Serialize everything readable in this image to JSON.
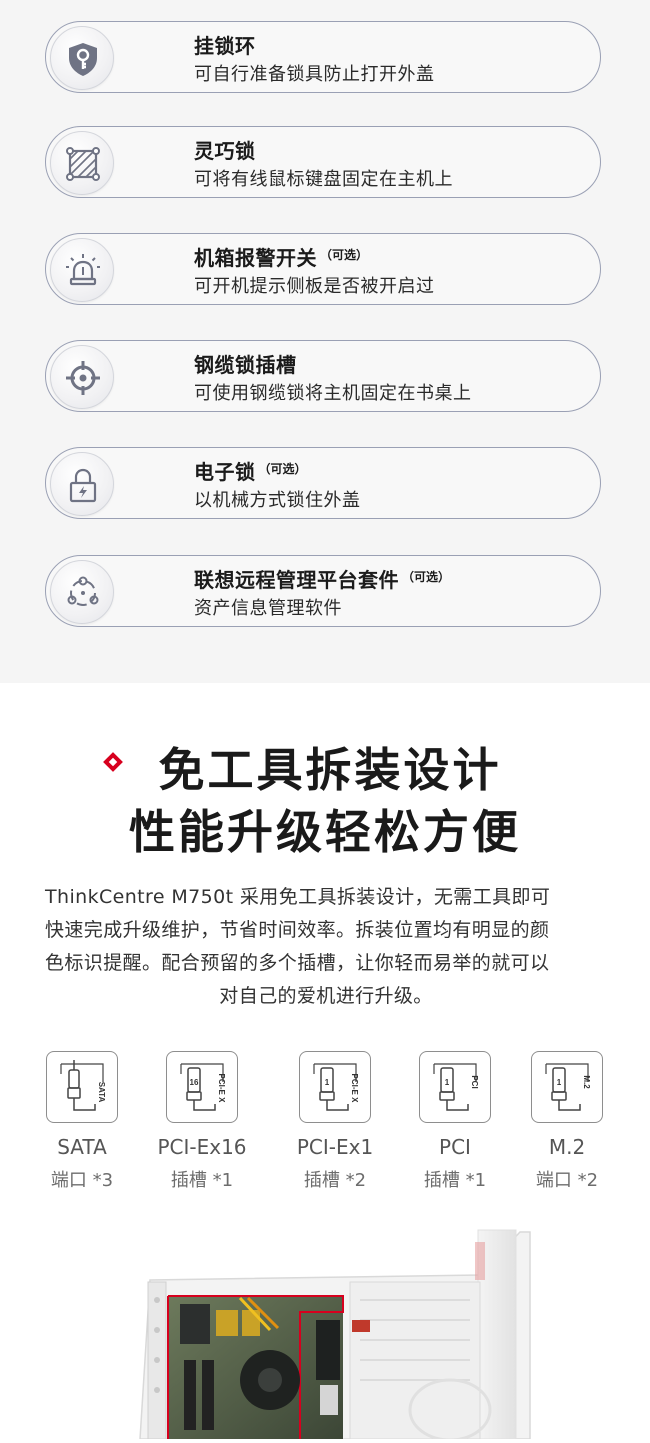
{
  "features": [
    {
      "title": "挂锁环",
      "optional": "",
      "desc": "可自行准备锁具防止打开外盖",
      "icon": "shield-key-icon"
    },
    {
      "title": "灵巧锁",
      "optional": "",
      "desc": "可将有线鼠标键盘固定在主机上",
      "icon": "smart-lock-icon"
    },
    {
      "title": "机箱报警开关",
      "optional": "（可选）",
      "desc": "可开机提示侧板是否被开启过",
      "icon": "alarm-light-icon"
    },
    {
      "title": "钢缆锁插槽",
      "optional": "",
      "desc": "可使用钢缆锁将主机固定在书桌上",
      "icon": "crosshair-icon"
    },
    {
      "title": "电子锁",
      "optional": "（可选）",
      "desc": "以机械方式锁住外盖",
      "icon": "electronic-lock-icon"
    },
    {
      "title": "联想远程管理平台套件",
      "optional": "（可选）",
      "desc": "资产信息管理软件",
      "icon": "remote-management-icon"
    }
  ],
  "headline": {
    "line1": "免工具拆装设计",
    "line2": "性能升级轻松方便"
  },
  "description": {
    "lines": [
      "ThinkCentre M750t 采用免工具拆装设计，无需工具即可",
      "快速完成升级维护，节省时间效率。拆装位置均有明显的颜",
      "色标识提醒。配合预留的多个插槽，让你轻而易举的就可以",
      "对自己的爱机进行升级。"
    ]
  },
  "slots": [
    {
      "name": "SATA",
      "count": "端口 *3",
      "label": "SATA",
      "num": ""
    },
    {
      "name": "PCI-Ex16",
      "count": "插槽 *1",
      "label": "PCI-E X",
      "num": "16"
    },
    {
      "name": "PCI-Ex1",
      "count": "插槽 *2",
      "label": "PCI-E X",
      "num": "1"
    },
    {
      "name": "PCI",
      "count": "插槽 *1",
      "label": "PCI",
      "num": "1"
    },
    {
      "name": "M.2",
      "count": "端口 *2",
      "label": "M.2",
      "num": "1"
    }
  ],
  "colors": {
    "accent": "#d7001e",
    "icon_gray": "#6f7384",
    "pill_border": "#9aa0b4"
  }
}
